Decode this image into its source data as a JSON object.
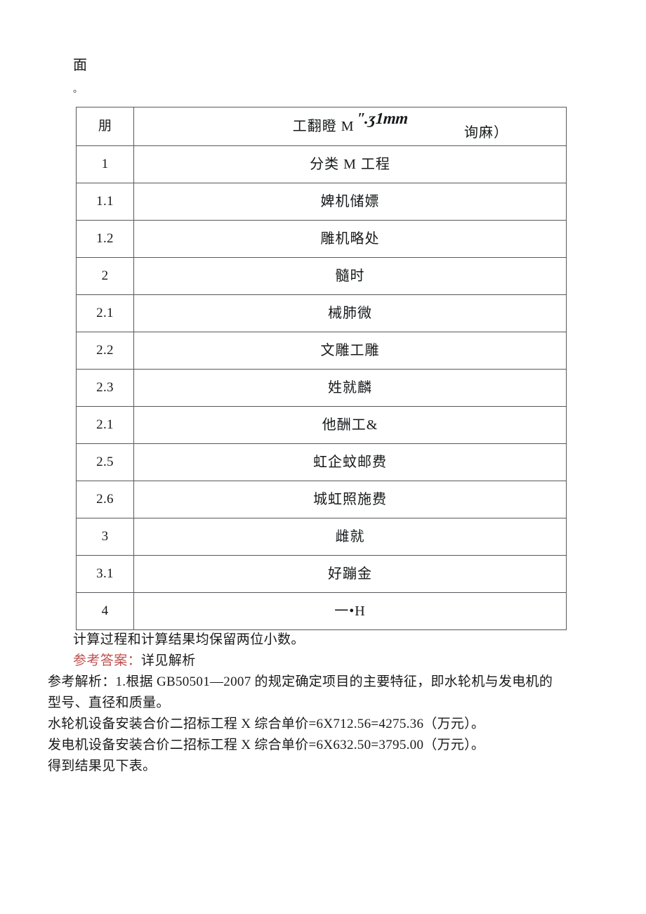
{
  "document": {
    "fragment_top": "面",
    "fragment_period": "。",
    "table": {
      "header": {
        "col_num": "朋",
        "col_name_base": "工翻瞪 M",
        "col_name_superscript": "ʺ.ʒ1mm",
        "col_name_tail": "询麻）"
      },
      "rows": [
        {
          "num": "1",
          "name": "分类 M 工程"
        },
        {
          "num": "1.1",
          "name": "婢机储嫖"
        },
        {
          "num": "1.2",
          "name": "雕机略处"
        },
        {
          "num": "2",
          "name": "髓时"
        },
        {
          "num": "2.1",
          "name": "械肺微"
        },
        {
          "num": "2.2",
          "name": "文雕工雕"
        },
        {
          "num": "2.3",
          "name": "姓就麟"
        },
        {
          "num": "2.1",
          "name": "他酬工&"
        },
        {
          "num": "2.5",
          "name": "虹企蚊邮费"
        },
        {
          "num": "2.6",
          "name": "城虹照施费"
        },
        {
          "num": "3",
          "name": "雌就"
        },
        {
          "num": "3.1",
          "name": "好蹦金"
        },
        {
          "num": "4",
          "name": "一•H"
        }
      ]
    },
    "notes": {
      "precision_note": "计算过程和计算结果均保留两位小数。",
      "answer_label": "参考答案：",
      "answer_value": "详见解析",
      "analysis_line_1": "参考解析：1.根据 GB50501—2007 的规定确定项目的主要特征，即水轮机与发电机的",
      "analysis_line_2": "型号、直径和质量。",
      "analysis_line_3": "水轮机设备安装合价二招标工程 X 综合单价=6X712.56=4275.36（万元）。",
      "analysis_line_4": "发电机设备安装合价二招标工程 X 综合单价=6X632.50=3795.00（万元）。",
      "analysis_line_5": "得到结果见下表。"
    }
  },
  "colors": {
    "answer_red": "#c0504d",
    "table_border": "#55585c",
    "text": "#16181a"
  }
}
